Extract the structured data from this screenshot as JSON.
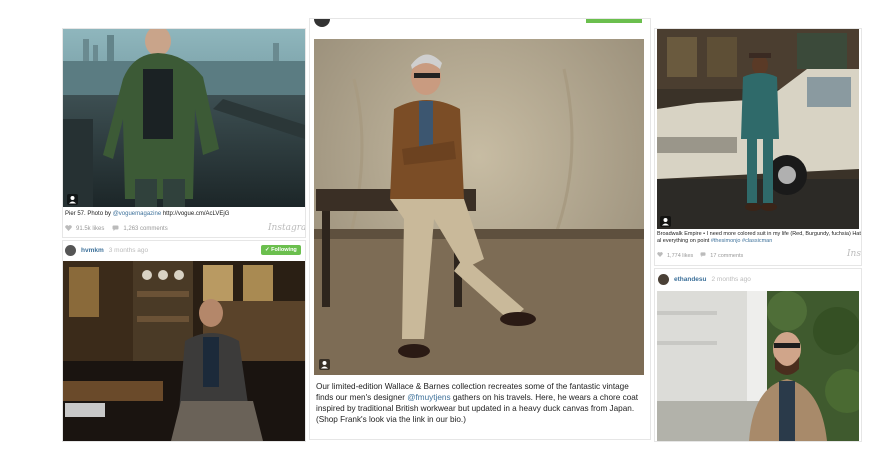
{
  "col1": {
    "post1": {
      "caption_prefix": "Pier 57. Photo by ",
      "caption_handle": "@voguemagazine",
      "caption_suffix": " http://vogue.cm/AcLVEjG",
      "likes": "91.5k likes",
      "comments": "1,263 comments",
      "brand": "Instagram"
    },
    "post2": {
      "username": "hvmkm",
      "time_ago": "3 months ago",
      "follow_label": "✓ Following"
    }
  },
  "col2": {
    "caption_part1": "Our limited-edition Wallace & Barnes collection recreates some of the fantastic vintage finds our men's designer ",
    "caption_handle": "@fmuytjens",
    "caption_part2": " gathers on his travels. Here, he wears a chore coat inspired by traditional British workwear but updated in a heavy duck canvas from Japan. (Shop Frank's look via the link in our bio.)"
  },
  "col3": {
    "post1": {
      "caption_part1": "Broadwalk Empire • I need more colored suit in my life (Red, Burgundy, fuchsia) Hat al everything on point ",
      "caption_tags": "#thesimonjo #classicman",
      "likes": "1,774 likes",
      "comments": "17 comments",
      "brand": "Ins"
    },
    "post2": {
      "username": "ethandesu",
      "time_ago": "2 months ago"
    }
  },
  "colors": {
    "link": "#3f729b",
    "follow_green": "#6bbf4e"
  }
}
